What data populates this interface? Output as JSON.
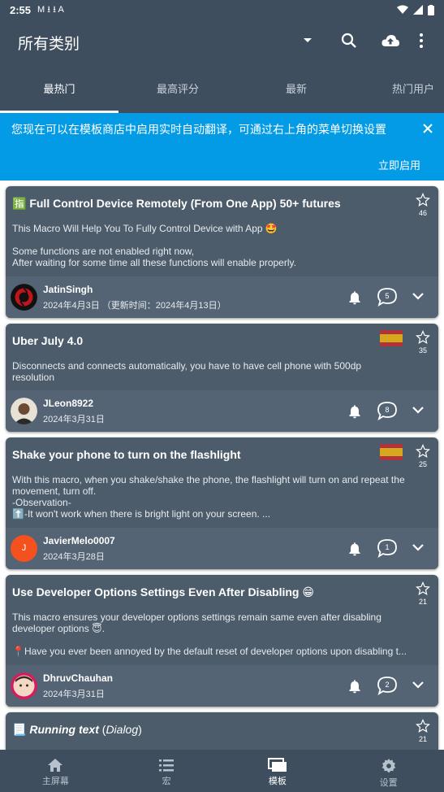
{
  "status": {
    "time": "2:55",
    "left_icons": "M ⭳ ⭳ A"
  },
  "appbar": {
    "title": "所有类别"
  },
  "tabs": [
    {
      "label": "最热门"
    },
    {
      "label": "最高评分"
    },
    {
      "label": "最新"
    },
    {
      "label": "热门用户"
    }
  ],
  "banner": {
    "message": "您现在可以在模板商店中启用实时自动翻译，可通过右上角的菜单切换设置",
    "action": "立即启用"
  },
  "cards": [
    {
      "title": "🈯 Full Control Device Remotely (From One App) 50+ futures",
      "body_lines": [
        "This Macro Will Help You To Fully Control Device with App 🤩",
        "",
        "Some functions are not enabled right now,",
        "After waiting for some time all these functions will enable properly."
      ],
      "stars": "46",
      "user": "JatinSingh",
      "date": "2024年4月3日 （更新时间：2024年4月13日）",
      "comments": "5"
    },
    {
      "title": "Uber July 4.0",
      "body_lines": [
        "Disconnects and connects automatically, you have to have cell phone with 500dp",
        "resolution"
      ],
      "stars": "35",
      "user": "JLeon8922",
      "date": "2024年3月31日",
      "comments": "8"
    },
    {
      "title": "Shake your phone to turn on the flashlight",
      "body_lines": [
        "With this macro, when you shake/shake the phone, the flashlight will turn on and repeat the",
        "movement, turn off.",
        "-Observation-",
        "⬆️-It won't work when there is bright light on your screen. ..."
      ],
      "stars": "25",
      "user": "JavierMelo0007",
      "avatar_letter": "J",
      "date": "2024年3月28日",
      "comments": "1"
    },
    {
      "title": "Use Developer Options Settings Even After Disabling 😁",
      "body_lines": [
        "This macro ensures your developer options settings remain same even after disabling",
        "developer options 😇.",
        "",
        "📍Have you ever been annoyed by the default reset of developer options upon disabling t..."
      ],
      "stars": "21",
      "user": "DhruvChauhan",
      "date": "2024年3月31日",
      "comments": "2"
    },
    {
      "title_bold_italic": "Running text",
      "title_rest": " (Dialog)",
      "title_icon": "📃",
      "stars": "21"
    }
  ],
  "bottomnav": [
    {
      "label": "主屏幕",
      "icon": "home-icon"
    },
    {
      "label": "宏",
      "icon": "list-icon"
    },
    {
      "label": "模板",
      "icon": "templates-icon"
    },
    {
      "label": "设置",
      "icon": "gear-icon"
    }
  ]
}
